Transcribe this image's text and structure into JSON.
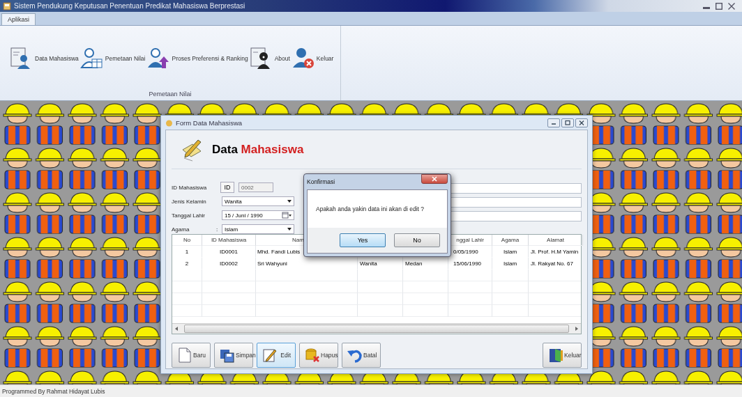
{
  "window": {
    "title": "Sistem Pendukung Keputusan Penentuan Predikat Mahasiswa Berprestasi"
  },
  "ribbon": {
    "tabs": [
      {
        "label": "Aplikasi",
        "selected": true
      }
    ],
    "group": {
      "label": "Pemetaan Nilai",
      "items": [
        {
          "label": "Data Mahasiswa",
          "kind": "student-card"
        },
        {
          "label": "Pemetaan Nilai",
          "kind": "grade-table"
        },
        {
          "label": "Proses Preferensi & Ranking",
          "kind": "upload"
        },
        {
          "label": "About",
          "kind": "about"
        },
        {
          "label": "Keluar",
          "kind": "exit"
        }
      ]
    }
  },
  "form": {
    "title": "Form Data Mahasiswa",
    "heading": {
      "first": "Data",
      "second": "Mahasiswa"
    },
    "fields": [
      {
        "label": "ID Mahasiswa",
        "kind": "id",
        "prefix": "ID",
        "value": "0002"
      },
      {
        "label": "Jenis Kelamin",
        "kind": "dropdown",
        "value": "Wanita"
      },
      {
        "label": "Tanggal Lahir",
        "kind": "date",
        "value": "15 / Juni / 1990"
      },
      {
        "label": "Agama",
        "kind": "dropdown",
        "prefix": ":",
        "value": "Islam"
      }
    ],
    "table": {
      "columns": [
        "No",
        "ID Mahasiswa",
        "Nam",
        null,
        null,
        "nggal Lahir",
        "Agama",
        "Alamat"
      ],
      "rows": [
        {
          "cells": [
            "1",
            "ID0001",
            "Mhd. Fandi Lubis",
            null,
            null,
            "0/05/1990",
            "Islam",
            "Jl. Prof. H.M Yamin"
          ]
        },
        {
          "cells": [
            "2",
            "ID0002",
            "Sri Wahyuni",
            "Wanita",
            "Medan",
            "15/06/1990",
            "Islam",
            "Jl. Rakyat No. 67"
          ]
        }
      ]
    },
    "buttons": [
      {
        "label": "Baru",
        "kind": "new",
        "focused": false
      },
      {
        "label": "Simpan",
        "kind": "save",
        "focused": false
      },
      {
        "label": "Edit",
        "kind": "edit",
        "focused": true
      },
      {
        "label": "Hapus",
        "kind": "delete",
        "focused": false
      },
      {
        "label": "Batal",
        "kind": "undo",
        "focused": false
      },
      {
        "label": "Keluar",
        "kind": "exit",
        "focused": false
      }
    ]
  },
  "dialog": {
    "title": "Konfirmasi",
    "message": "Apakah anda yakin data ini akan di edit ?",
    "buttons": [
      {
        "label": "Yes",
        "focused": true
      },
      {
        "label": "No",
        "focused": false
      }
    ]
  },
  "status_bar": {
    "text": "Programmed By Rahmat Hidayat Lubis"
  }
}
